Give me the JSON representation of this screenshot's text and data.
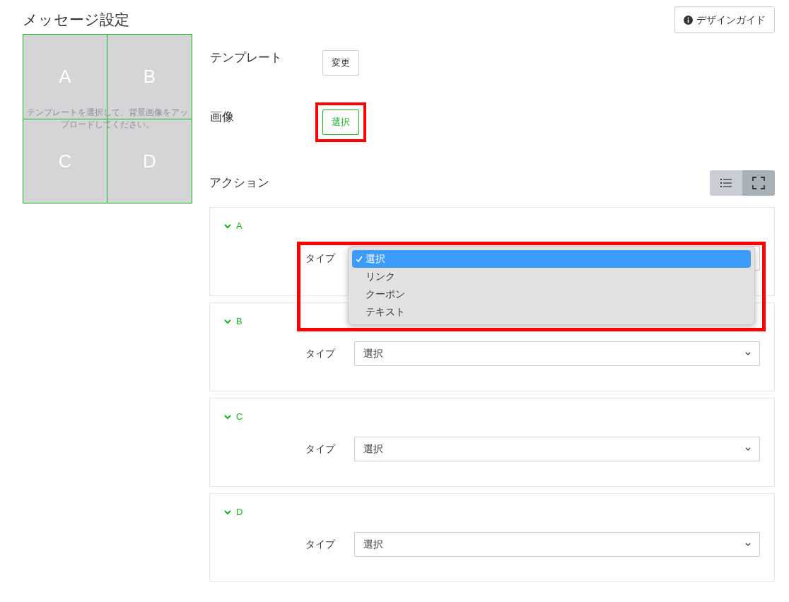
{
  "title": "メッセージ設定",
  "design_guide_button": "デザインガイド",
  "preview": {
    "hint": "テンプレートを選択して、背景画像をアップロードしてください。",
    "areas": [
      "A",
      "B",
      "C",
      "D"
    ]
  },
  "template": {
    "label": "テンプレート",
    "button": "変更"
  },
  "image": {
    "label": "画像",
    "button": "選択",
    "highlighted": true
  },
  "actions": {
    "label": "アクション",
    "view_toggle": [
      {
        "selected": false
      },
      {
        "selected": true
      }
    ],
    "items": [
      {
        "name": "A",
        "expanded": true,
        "type_label": "タイプ",
        "open": true,
        "highlighted": true,
        "options": [
          {
            "label": "選択",
            "selected": true
          },
          {
            "label": "リンク",
            "selected": false
          },
          {
            "label": "クーポン",
            "selected": false
          },
          {
            "label": "テキスト",
            "selected": false
          }
        ]
      },
      {
        "name": "B",
        "expanded": true,
        "type_label": "タイプ",
        "value": "選択"
      },
      {
        "name": "C",
        "expanded": true,
        "type_label": "タイプ",
        "value": "選択"
      },
      {
        "name": "D",
        "expanded": true,
        "type_label": "タイプ",
        "value": "選択"
      }
    ]
  }
}
